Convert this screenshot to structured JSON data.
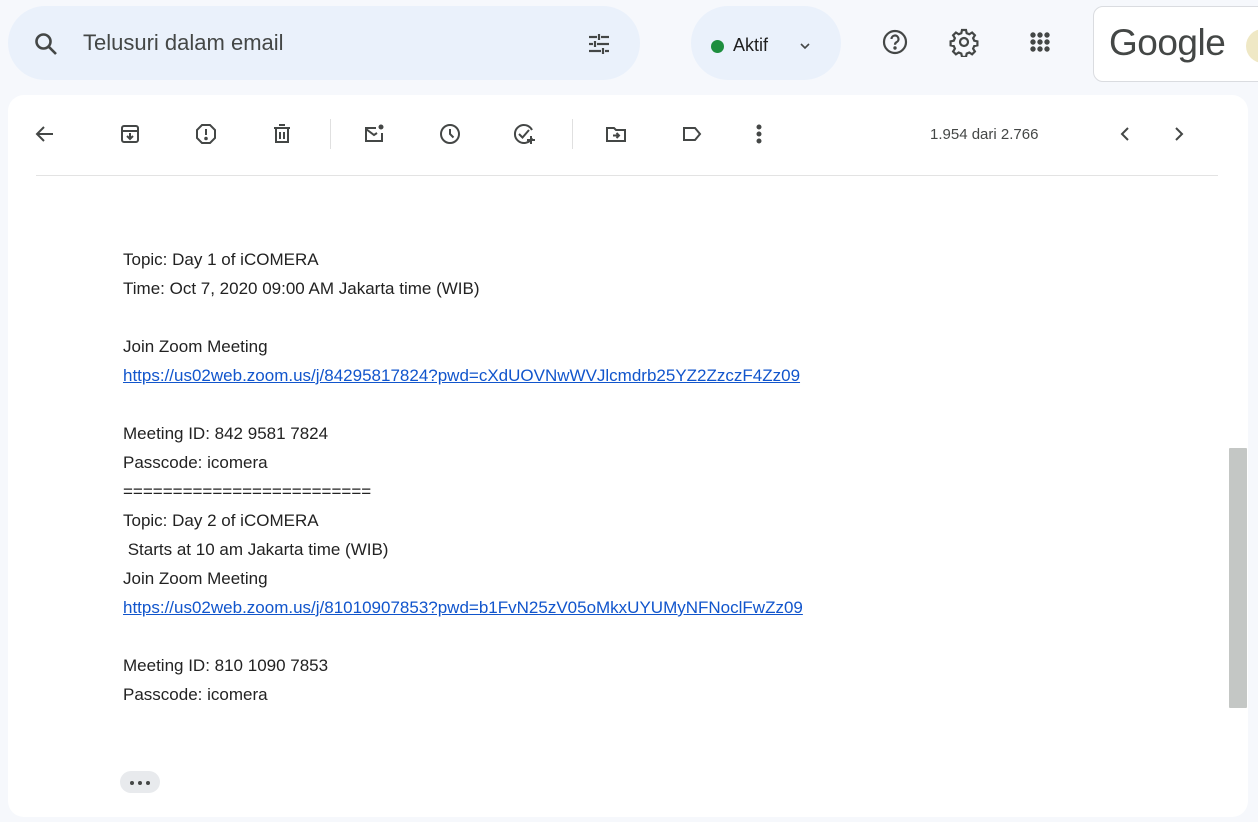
{
  "search": {
    "placeholder": "Telusuri dalam email"
  },
  "status": {
    "label": "Aktif",
    "color": "#1e8e3e"
  },
  "header_icons": [
    "filter-icon",
    "help-icon",
    "settings-icon",
    "apps-icon"
  ],
  "brand": {
    "logo_text": "Google"
  },
  "toolbar": {
    "icons": [
      "back-arrow-icon",
      "archive-icon",
      "report-spam-icon",
      "delete-icon",
      "mark-unread-icon",
      "snooze-icon",
      "add-task-icon",
      "move-to-icon",
      "label-icon",
      "more-vert-icon",
      "chevron-left-icon",
      "chevron-right-icon"
    ],
    "pager_text": "1.954 dari 2.766"
  },
  "message": {
    "lines": [
      "Topic: Day 1 of iCOMERA",
      "Time: Oct 7, 2020 09:00 AM Jakarta time (WIB)",
      "",
      "Join Zoom Meeting",
      "https://us02web.zoom.us/j/84295817824?pwd=cXdUOVNwWVJlcmdrb25YZ2ZzczF4Zz09",
      "",
      "Meeting ID: 842 9581 7824",
      "Passcode: icomera",
      "=========================",
      "Topic: Day 2 of iCOMERA",
      " Starts at 10 am Jakarta time (WIB)",
      "Join Zoom Meeting",
      "https://us02web.zoom.us/j/81010907853?pwd=b1FvN25zV05oMkxUYUMyNFNoclFwZz09",
      "",
      "Meeting ID: 810 1090 7853",
      "Passcode: icomera"
    ]
  },
  "colors": {
    "page_bg": "#f6f8fc",
    "search_bg": "#eaf1fb",
    "link": "#1155cc",
    "icon": "#444746"
  }
}
